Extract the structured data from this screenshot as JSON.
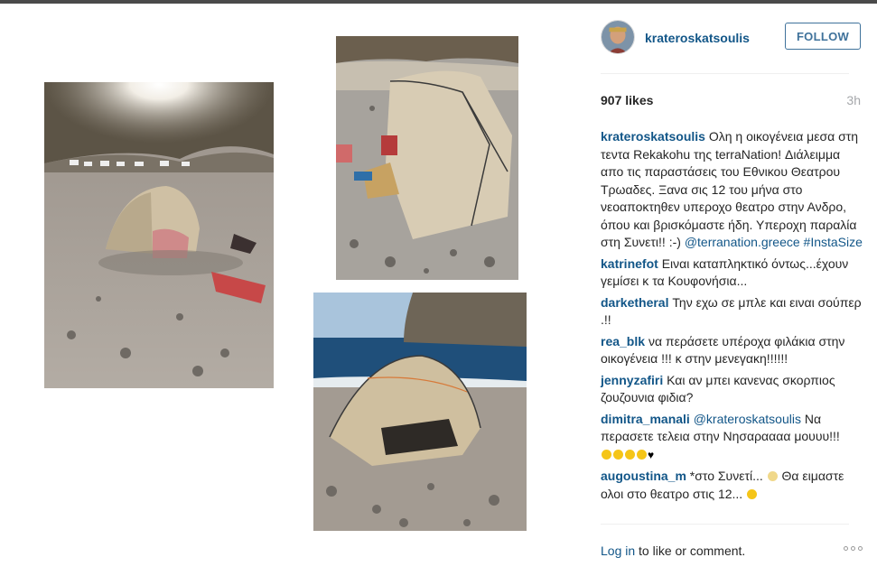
{
  "post": {
    "username": "krateroskatsoulis",
    "follow_label": "FOLLOW",
    "likes": "907 likes",
    "time": "3h",
    "caption": {
      "user": "krateroskatsoulis",
      "text": "Ολη η οικογένεια μεσα στη τεντα Rekakohu της terraNation! Διάλειμμα απο τις παραστάσεις του Εθνικου Θεατρου Τρωαδες. Ξανα σις 12 του μήνα στο νεοαποκτηθεν υπεροχο θεατρο στην Ανδρο, όπου και βρισκόμαστε ήδη. Υπεροχη παραλία στη Συνετι!! :-)",
      "mention": "@terranation.greece",
      "hashtag": "#InstaSize"
    },
    "comments": [
      {
        "user": "katrinefot",
        "text": "Ειναι καταπληκτικό όντως...έχουν γεμίσει κ τα Κουφονήσια..."
      },
      {
        "user": "darketheral",
        "text": "Την εχω σε μπλε και ειναι σούπερ .!!"
      },
      {
        "user": "rea_blk",
        "text": "να περάσετε υπέροχα φιλάκια στην οικογένεια !!! κ στην μενεγακη!!!!!!"
      },
      {
        "user": "jennyzafiri",
        "text": "Και αν μπει κανενας σκορπιος ζουζουνια φιδια?"
      },
      {
        "user": "dimitra_manali",
        "mention": "@krateroskatsoulis",
        "text": "Να περασετε τελεια στην Νησαραααα μουυυ!!!"
      },
      {
        "user": "augoustina_m",
        "text": "*στο Συνετί...",
        "text2": "Θα ειμαστε ολοι στο θεατρο στις 12..."
      }
    ],
    "footer": {
      "login_link": "Log in",
      "login_text": "to like or comment."
    }
  },
  "icons": {
    "avatar": "avatar",
    "more": "more-options-icon",
    "emoji": "smiley-emoji-icon",
    "heart": "black-heart-icon"
  },
  "colors": {
    "link": "#125688",
    "follow": "#3f729b",
    "text": "#262626",
    "muted": "#a5a7aa"
  }
}
